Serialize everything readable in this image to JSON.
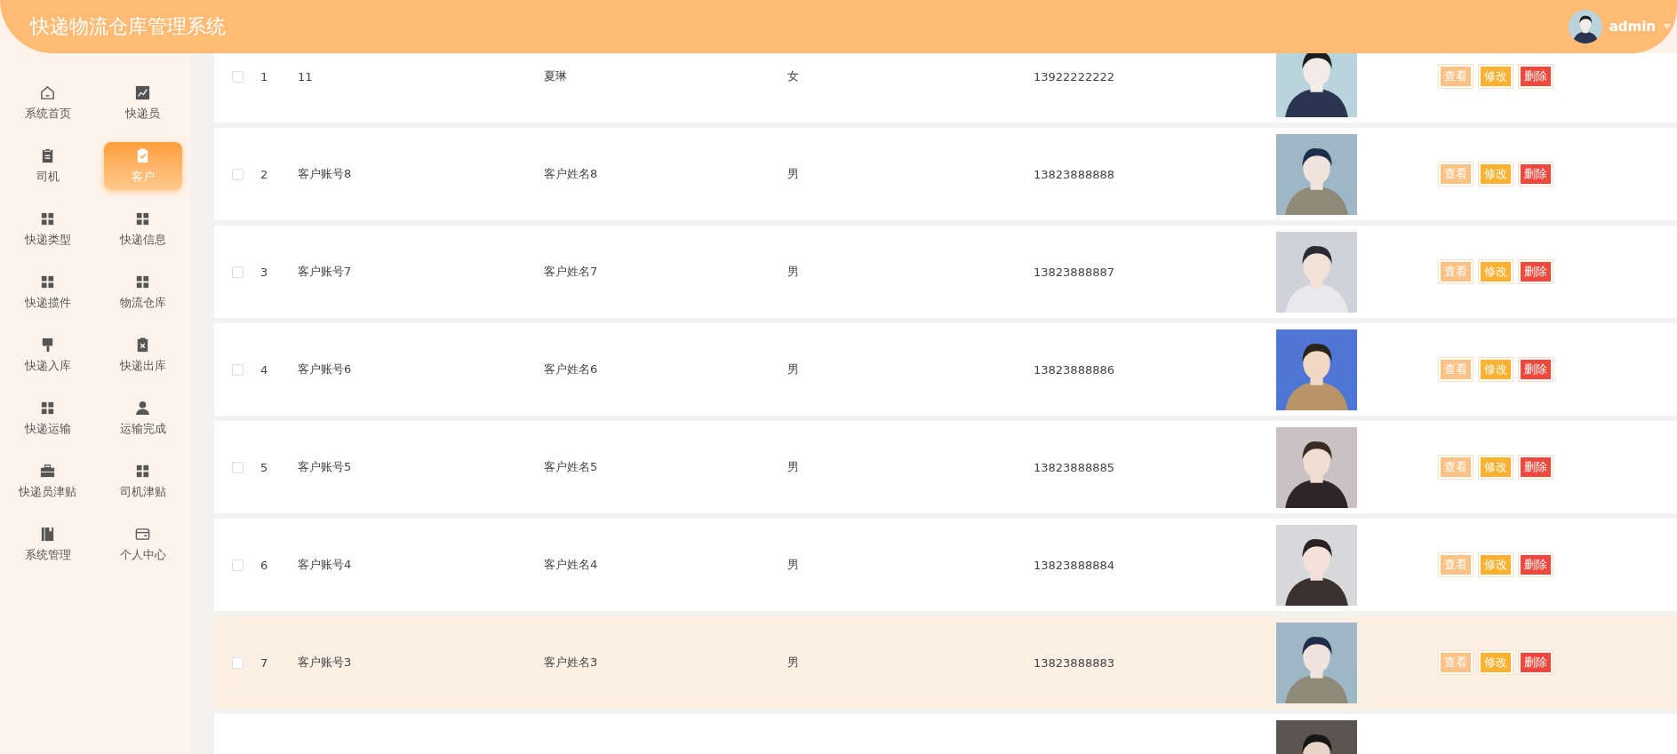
{
  "header": {
    "title": "快递物流仓库管理系统",
    "user": "admin"
  },
  "sidebar": {
    "items": [
      {
        "label": "系统首页",
        "kind": "home",
        "selected": false
      },
      {
        "label": "快递员",
        "kind": "chart",
        "selected": false
      },
      {
        "label": "司机",
        "kind": "clipboard",
        "selected": false
      },
      {
        "label": "客户",
        "kind": "clipboard-check",
        "selected": true
      },
      {
        "label": "快递类型",
        "kind": "grid",
        "selected": false
      },
      {
        "label": "快递信息",
        "kind": "grid",
        "selected": false
      },
      {
        "label": "快递揽件",
        "kind": "grid",
        "selected": false
      },
      {
        "label": "物流仓库",
        "kind": "grid",
        "selected": false
      },
      {
        "label": "快递入库",
        "kind": "brush",
        "selected": false
      },
      {
        "label": "快递出库",
        "kind": "clipboard-x",
        "selected": false
      },
      {
        "label": "快递运输",
        "kind": "grid",
        "selected": false
      },
      {
        "label": "运输完成",
        "kind": "user",
        "selected": false
      },
      {
        "label": "快递员津贴",
        "kind": "briefcase",
        "selected": false
      },
      {
        "label": "司机津贴",
        "kind": "grid",
        "selected": false
      },
      {
        "label": "系统管理",
        "kind": "books",
        "selected": false
      },
      {
        "label": "个人中心",
        "kind": "wallet",
        "selected": false
      }
    ]
  },
  "table": {
    "rows": [
      {
        "selected": false,
        "hovered": false,
        "index": "1",
        "account": "11",
        "name": "夏琳",
        "gender": "女",
        "phone": "13922222222",
        "actions": [
          "查看",
          "修改",
          "删除"
        ]
      },
      {
        "selected": false,
        "hovered": false,
        "index": "2",
        "account": "客户账号8",
        "name": "客户姓名8",
        "gender": "男",
        "phone": "13823888888",
        "actions": [
          "查看",
          "修改",
          "删除"
        ]
      },
      {
        "selected": false,
        "hovered": false,
        "index": "3",
        "account": "客户账号7",
        "name": "客户姓名7",
        "gender": "男",
        "phone": "13823888887",
        "actions": [
          "查看",
          "修改",
          "删除"
        ]
      },
      {
        "selected": false,
        "hovered": false,
        "index": "4",
        "account": "客户账号6",
        "name": "客户姓名6",
        "gender": "男",
        "phone": "13823888886",
        "actions": [
          "查看",
          "修改",
          "删除"
        ]
      },
      {
        "selected": false,
        "hovered": false,
        "index": "5",
        "account": "客户账号5",
        "name": "客户姓名5",
        "gender": "男",
        "phone": "13823888885",
        "actions": [
          "查看",
          "修改",
          "删除"
        ]
      },
      {
        "selected": false,
        "hovered": false,
        "index": "6",
        "account": "客户账号4",
        "name": "客户姓名4",
        "gender": "男",
        "phone": "13823888884",
        "actions": [
          "查看",
          "修改",
          "删除"
        ]
      },
      {
        "selected": false,
        "hovered": true,
        "index": "7",
        "account": "客户账号3",
        "name": "客户姓名3",
        "gender": "男",
        "phone": "13823888883",
        "actions": [
          "查看",
          "修改",
          "删除"
        ]
      }
    ]
  }
}
